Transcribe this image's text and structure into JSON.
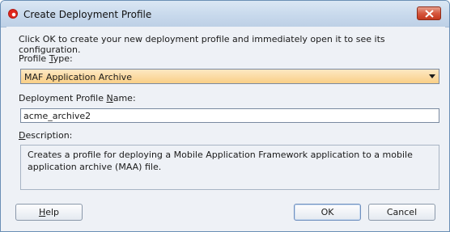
{
  "window": {
    "title": "Create Deployment Profile"
  },
  "intro_text": "Click OK to create your new deployment profile and immediately open it to see its configuration.",
  "profile_type": {
    "label_pre": "Profile ",
    "label_mnemonic": "T",
    "label_post": "ype:",
    "selected_value": "MAF Application Archive"
  },
  "profile_name": {
    "label_pre": "Deployment Profile ",
    "label_mnemonic": "N",
    "label_post": "ame:",
    "value": "acme_archive2"
  },
  "description": {
    "label_mnemonic": "D",
    "label_post": "escription:",
    "text": "Creates a profile for deploying a Mobile Application Framework application to a mobile application archive (MAA) file."
  },
  "buttons": {
    "help_mnemonic": "H",
    "help_rest": "elp",
    "ok": "OK",
    "cancel": "Cancel"
  },
  "colors": {
    "dropdown_highlight": "#f9cf86",
    "window_border": "#6b8fb5",
    "close_button": "#d6573e"
  }
}
